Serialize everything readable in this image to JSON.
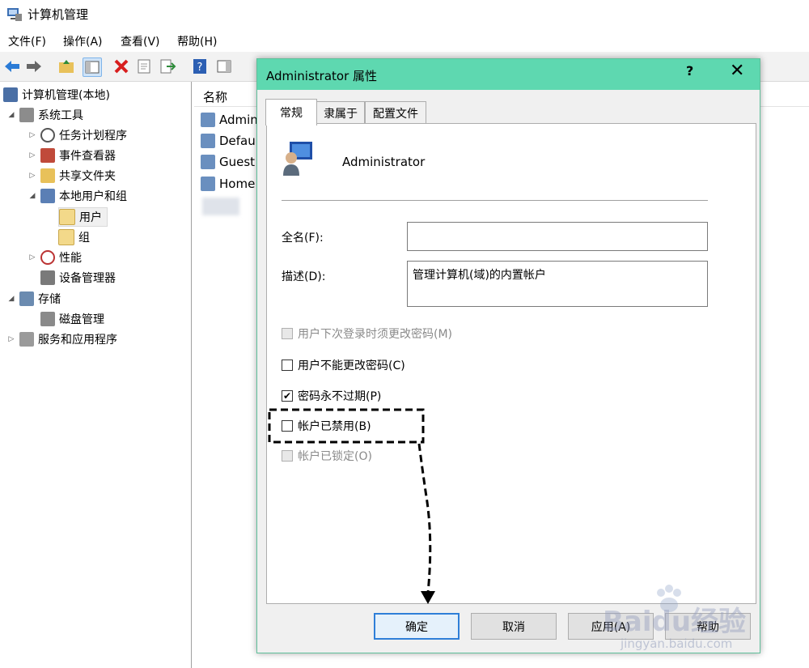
{
  "window": {
    "title": "计算机管理"
  },
  "menu": [
    "文件(F)",
    "操作(A)",
    "查看(V)",
    "帮助(H)"
  ],
  "toolbar_icons": [
    "back-arrow-icon",
    "forward-arrow-icon",
    "folder-up-icon",
    "show-hide-tree-icon",
    "delete-icon",
    "properties-icon",
    "export-icon",
    "help-icon",
    "action-pane-icon"
  ],
  "tree": {
    "root": "计算机管理(本地)",
    "system_tools": "系统工具",
    "task_scheduler": "任务计划程序",
    "event_viewer": "事件查看器",
    "shared_folders": "共享文件夹",
    "local_users_groups": "本地用户和组",
    "users": "用户",
    "groups": "组",
    "performance": "性能",
    "device_manager": "设备管理器",
    "storage": "存储",
    "disk_management": "磁盘管理",
    "services_apps": "服务和应用程序"
  },
  "list": {
    "header": "名称",
    "items": [
      "Admin",
      "Defaul",
      "Guest",
      "Home"
    ]
  },
  "dialog": {
    "title": "Administrator 属性",
    "help": "?",
    "close": "✕",
    "tabs": [
      "常规",
      "隶属于",
      "配置文件"
    ],
    "username": "Administrator",
    "fullname_label": "全名(F):",
    "fullname_value": "",
    "description_label": "描述(D):",
    "description_value": "管理计算机(域)的内置帐户",
    "checkboxes": [
      {
        "label": "用户下次登录时须更改密码(M)",
        "checked": false,
        "disabled": true
      },
      {
        "label": "用户不能更改密码(C)",
        "checked": false,
        "disabled": false
      },
      {
        "label": "密码永不过期(P)",
        "checked": true,
        "disabled": false
      },
      {
        "label": "帐户已禁用(B)",
        "checked": false,
        "disabled": false
      },
      {
        "label": "帐户已锁定(O)",
        "checked": false,
        "disabled": true
      }
    ],
    "buttons": {
      "ok": "确定",
      "cancel": "取消",
      "apply": "应用(A)",
      "help": "帮助"
    }
  },
  "watermark": {
    "text": "Baidu经验",
    "url": "jingyan.baidu.com"
  },
  "colors": {
    "dialog_title": "#5ed8b0",
    "annotation": "#000000",
    "default_button": "#2f7fd8"
  }
}
